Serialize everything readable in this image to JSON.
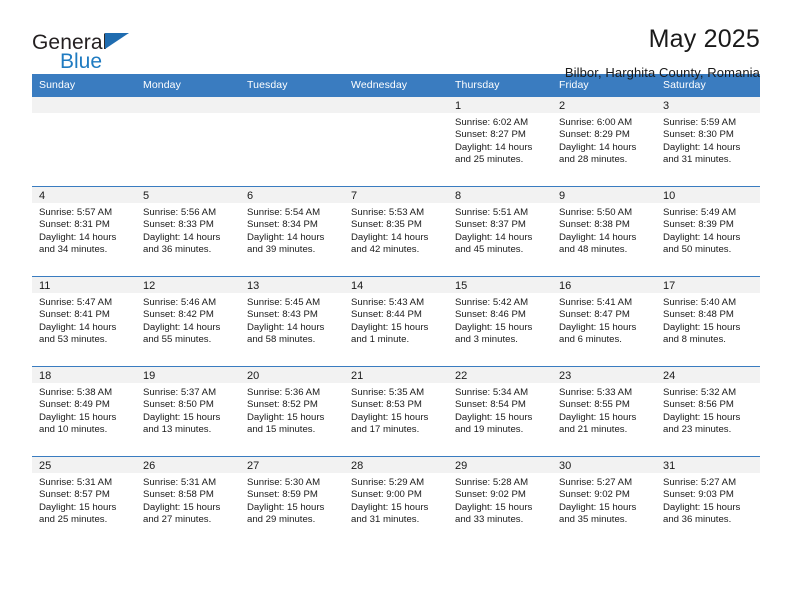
{
  "brand": {
    "name_top": "General",
    "name_bottom": "Blue",
    "flag_icon": "triangle-flag-icon",
    "accent_color": "#1f7bc1"
  },
  "header": {
    "title": "May 2025",
    "subtitle": "Bilbor, Harghita County, Romania"
  },
  "theme": {
    "header_blue": "#3a7cc0",
    "strip_gray": "#f2f2f2",
    "text_color": "#1a1a1a"
  },
  "calendar": {
    "weekday_headers": [
      "Sunday",
      "Monday",
      "Tuesday",
      "Wednesday",
      "Thursday",
      "Friday",
      "Saturday"
    ],
    "weeks": [
      [
        {
          "day": "",
          "empty": true,
          "sunrise": "",
          "sunset": "",
          "daylight": ""
        },
        {
          "day": "",
          "empty": true,
          "sunrise": "",
          "sunset": "",
          "daylight": ""
        },
        {
          "day": "",
          "empty": true,
          "sunrise": "",
          "sunset": "",
          "daylight": ""
        },
        {
          "day": "",
          "empty": true,
          "sunrise": "",
          "sunset": "",
          "daylight": ""
        },
        {
          "day": "1",
          "empty": false,
          "sunrise": "Sunrise: 6:02 AM",
          "sunset": "Sunset: 8:27 PM",
          "daylight": "Daylight: 14 hours and 25 minutes."
        },
        {
          "day": "2",
          "empty": false,
          "sunrise": "Sunrise: 6:00 AM",
          "sunset": "Sunset: 8:29 PM",
          "daylight": "Daylight: 14 hours and 28 minutes."
        },
        {
          "day": "3",
          "empty": false,
          "sunrise": "Sunrise: 5:59 AM",
          "sunset": "Sunset: 8:30 PM",
          "daylight": "Daylight: 14 hours and 31 minutes."
        }
      ],
      [
        {
          "day": "4",
          "empty": false,
          "sunrise": "Sunrise: 5:57 AM",
          "sunset": "Sunset: 8:31 PM",
          "daylight": "Daylight: 14 hours and 34 minutes."
        },
        {
          "day": "5",
          "empty": false,
          "sunrise": "Sunrise: 5:56 AM",
          "sunset": "Sunset: 8:33 PM",
          "daylight": "Daylight: 14 hours and 36 minutes."
        },
        {
          "day": "6",
          "empty": false,
          "sunrise": "Sunrise: 5:54 AM",
          "sunset": "Sunset: 8:34 PM",
          "daylight": "Daylight: 14 hours and 39 minutes."
        },
        {
          "day": "7",
          "empty": false,
          "sunrise": "Sunrise: 5:53 AM",
          "sunset": "Sunset: 8:35 PM",
          "daylight": "Daylight: 14 hours and 42 minutes."
        },
        {
          "day": "8",
          "empty": false,
          "sunrise": "Sunrise: 5:51 AM",
          "sunset": "Sunset: 8:37 PM",
          "daylight": "Daylight: 14 hours and 45 minutes."
        },
        {
          "day": "9",
          "empty": false,
          "sunrise": "Sunrise: 5:50 AM",
          "sunset": "Sunset: 8:38 PM",
          "daylight": "Daylight: 14 hours and 48 minutes."
        },
        {
          "day": "10",
          "empty": false,
          "sunrise": "Sunrise: 5:49 AM",
          "sunset": "Sunset: 8:39 PM",
          "daylight": "Daylight: 14 hours and 50 minutes."
        }
      ],
      [
        {
          "day": "11",
          "empty": false,
          "sunrise": "Sunrise: 5:47 AM",
          "sunset": "Sunset: 8:41 PM",
          "daylight": "Daylight: 14 hours and 53 minutes."
        },
        {
          "day": "12",
          "empty": false,
          "sunrise": "Sunrise: 5:46 AM",
          "sunset": "Sunset: 8:42 PM",
          "daylight": "Daylight: 14 hours and 55 minutes."
        },
        {
          "day": "13",
          "empty": false,
          "sunrise": "Sunrise: 5:45 AM",
          "sunset": "Sunset: 8:43 PM",
          "daylight": "Daylight: 14 hours and 58 minutes."
        },
        {
          "day": "14",
          "empty": false,
          "sunrise": "Sunrise: 5:43 AM",
          "sunset": "Sunset: 8:44 PM",
          "daylight": "Daylight: 15 hours and 1 minute."
        },
        {
          "day": "15",
          "empty": false,
          "sunrise": "Sunrise: 5:42 AM",
          "sunset": "Sunset: 8:46 PM",
          "daylight": "Daylight: 15 hours and 3 minutes."
        },
        {
          "day": "16",
          "empty": false,
          "sunrise": "Sunrise: 5:41 AM",
          "sunset": "Sunset: 8:47 PM",
          "daylight": "Daylight: 15 hours and 6 minutes."
        },
        {
          "day": "17",
          "empty": false,
          "sunrise": "Sunrise: 5:40 AM",
          "sunset": "Sunset: 8:48 PM",
          "daylight": "Daylight: 15 hours and 8 minutes."
        }
      ],
      [
        {
          "day": "18",
          "empty": false,
          "sunrise": "Sunrise: 5:38 AM",
          "sunset": "Sunset: 8:49 PM",
          "daylight": "Daylight: 15 hours and 10 minutes."
        },
        {
          "day": "19",
          "empty": false,
          "sunrise": "Sunrise: 5:37 AM",
          "sunset": "Sunset: 8:50 PM",
          "daylight": "Daylight: 15 hours and 13 minutes."
        },
        {
          "day": "20",
          "empty": false,
          "sunrise": "Sunrise: 5:36 AM",
          "sunset": "Sunset: 8:52 PM",
          "daylight": "Daylight: 15 hours and 15 minutes."
        },
        {
          "day": "21",
          "empty": false,
          "sunrise": "Sunrise: 5:35 AM",
          "sunset": "Sunset: 8:53 PM",
          "daylight": "Daylight: 15 hours and 17 minutes."
        },
        {
          "day": "22",
          "empty": false,
          "sunrise": "Sunrise: 5:34 AM",
          "sunset": "Sunset: 8:54 PM",
          "daylight": "Daylight: 15 hours and 19 minutes."
        },
        {
          "day": "23",
          "empty": false,
          "sunrise": "Sunrise: 5:33 AM",
          "sunset": "Sunset: 8:55 PM",
          "daylight": "Daylight: 15 hours and 21 minutes."
        },
        {
          "day": "24",
          "empty": false,
          "sunrise": "Sunrise: 5:32 AM",
          "sunset": "Sunset: 8:56 PM",
          "daylight": "Daylight: 15 hours and 23 minutes."
        }
      ],
      [
        {
          "day": "25",
          "empty": false,
          "sunrise": "Sunrise: 5:31 AM",
          "sunset": "Sunset: 8:57 PM",
          "daylight": "Daylight: 15 hours and 25 minutes."
        },
        {
          "day": "26",
          "empty": false,
          "sunrise": "Sunrise: 5:31 AM",
          "sunset": "Sunset: 8:58 PM",
          "daylight": "Daylight: 15 hours and 27 minutes."
        },
        {
          "day": "27",
          "empty": false,
          "sunrise": "Sunrise: 5:30 AM",
          "sunset": "Sunset: 8:59 PM",
          "daylight": "Daylight: 15 hours and 29 minutes."
        },
        {
          "day": "28",
          "empty": false,
          "sunrise": "Sunrise: 5:29 AM",
          "sunset": "Sunset: 9:00 PM",
          "daylight": "Daylight: 15 hours and 31 minutes."
        },
        {
          "day": "29",
          "empty": false,
          "sunrise": "Sunrise: 5:28 AM",
          "sunset": "Sunset: 9:02 PM",
          "daylight": "Daylight: 15 hours and 33 minutes."
        },
        {
          "day": "30",
          "empty": false,
          "sunrise": "Sunrise: 5:27 AM",
          "sunset": "Sunset: 9:02 PM",
          "daylight": "Daylight: 15 hours and 35 minutes."
        },
        {
          "day": "31",
          "empty": false,
          "sunrise": "Sunrise: 5:27 AM",
          "sunset": "Sunset: 9:03 PM",
          "daylight": "Daylight: 15 hours and 36 minutes."
        }
      ]
    ]
  }
}
